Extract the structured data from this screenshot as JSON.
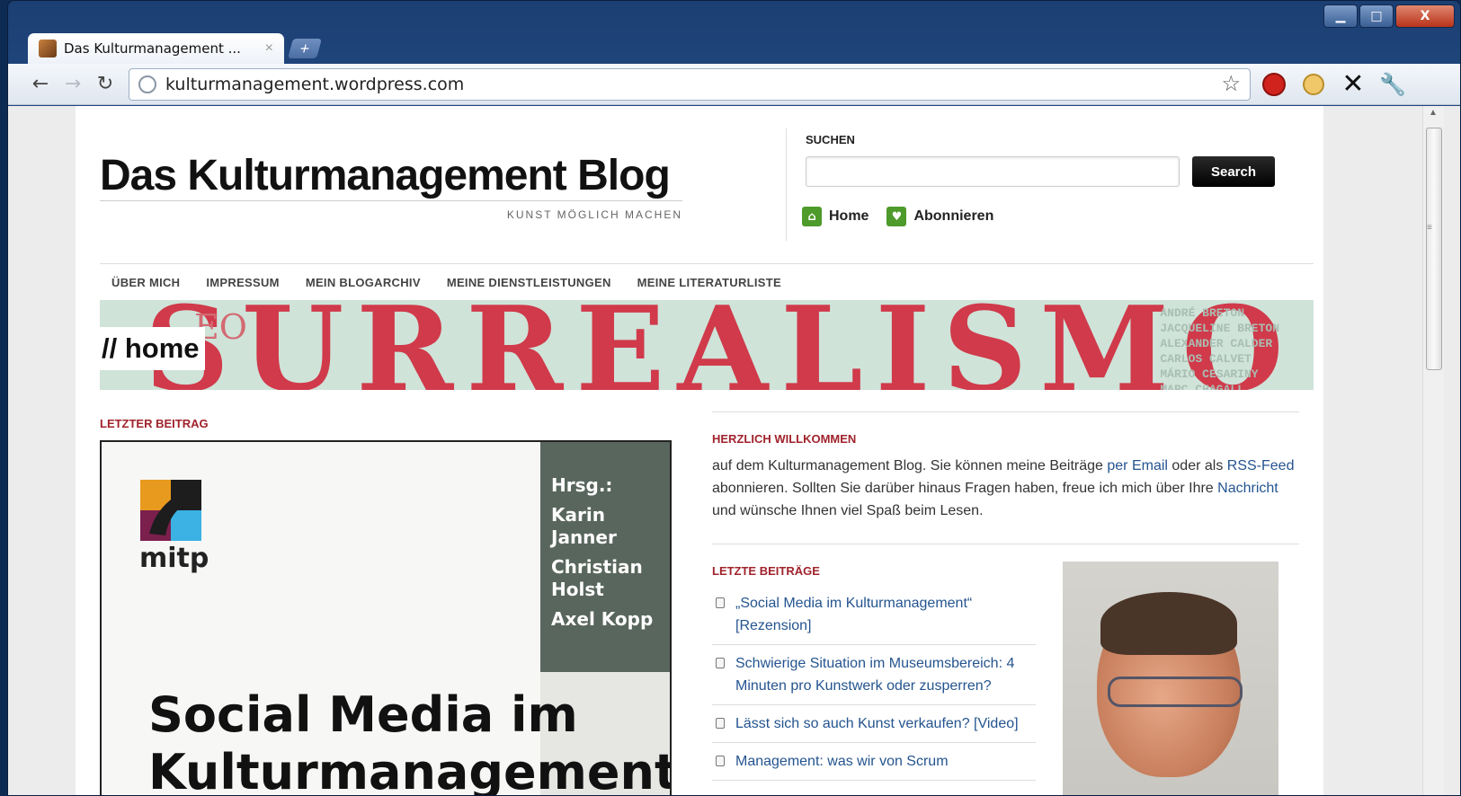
{
  "browser": {
    "tab_title": "Das Kulturmanagement ...",
    "tab_close": "×",
    "new_tab": "+",
    "url": "kulturmanagement.wordpress.com",
    "window_controls": {
      "minimize": "▁",
      "maximize": "□",
      "close": "X"
    }
  },
  "site": {
    "title": "Das Kulturmanagement Blog",
    "tagline": "KUNST MÖGLICH MACHEN"
  },
  "search": {
    "label": "SUCHEN",
    "input_value": "",
    "button": "Search"
  },
  "header_links": [
    {
      "label": "Home",
      "icon": "home-icon"
    },
    {
      "label": "Abonnieren",
      "icon": "heart-icon"
    }
  ],
  "nav": [
    "ÜBER MICH",
    "IMPRESSUM",
    "MEIN BLOGARCHIV",
    "MEINE DIENSTLEISTUNGEN",
    "MEINE LITERATURLISTE"
  ],
  "banner": {
    "big_text": "SURREALISMO",
    "small_text": "EO",
    "names": [
      "ANDRÉ BRETON",
      "JACQUELINE BRETON",
      "ALEXANDER CALDER",
      "CARLOS CALVET",
      "MÁRIO CESARINY",
      "MARC CHAGALL"
    ],
    "page_label": "// home"
  },
  "left": {
    "label": "LETZTER BEITRAG",
    "book": {
      "publisher": "mitp",
      "editor_label": "Hrsg.:",
      "authors": [
        "Karin Janner",
        "Christian Holst",
        "Axel Kopp"
      ],
      "title_line1": "Social Media im",
      "title_line2": "Kulturmanagement"
    }
  },
  "welcome": {
    "label": "HERZLICH WILLKOMMEN",
    "text1": "auf dem Kulturmanagement Blog. Sie können meine Beiträge ",
    "link1": "per Email",
    "text2": " oder als ",
    "link2": "RSS-Feed",
    "text3": " abonnieren. Sollten Sie darüber hinaus Fragen haben, freue ich mich über Ihre ",
    "link3": "Nachricht",
    "text4": " und wünsche Ihnen viel Spaß beim Lesen."
  },
  "recent": {
    "label": "LETZTE BEITRÄGE",
    "items": [
      "„Social Media im Kulturmanagement“ [Rezension]",
      "Schwierige Situation im Museumsbereich: 4 Minuten pro Kunstwerk oder zusperren?",
      "Lässt sich so auch Kunst verkaufen? [Video]",
      "Management: was wir von Scrum"
    ]
  },
  "colors": {
    "accent_red": "#a0232c",
    "link_blue": "#24548f",
    "icon_green": "#4e9a2b"
  }
}
